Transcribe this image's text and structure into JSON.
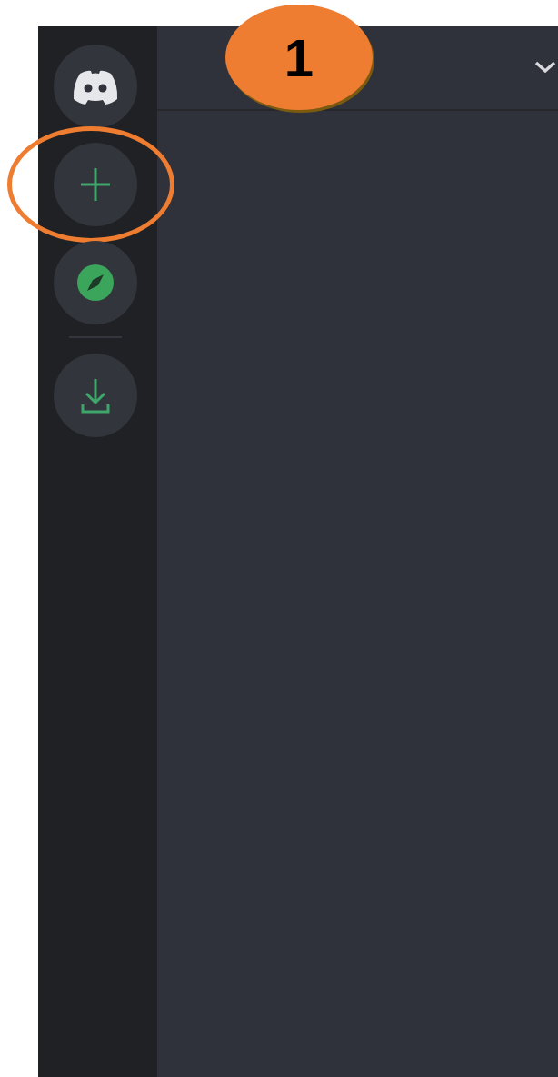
{
  "server_rail": {
    "items": [
      {
        "kind": "home",
        "highlighted": false
      },
      {
        "kind": "add",
        "highlighted": true
      },
      {
        "kind": "explore",
        "highlighted": false
      },
      {
        "kind": "download",
        "highlighted": false
      }
    ]
  },
  "callout": {
    "label": "1"
  }
}
